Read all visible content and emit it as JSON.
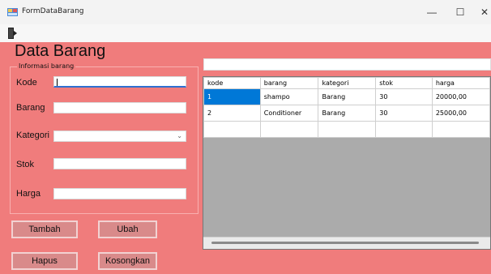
{
  "window": {
    "title": "FormDataBarang",
    "minimize": "—",
    "maximize": "☐",
    "close": "✕"
  },
  "form": {
    "heading": "Data Barang",
    "group_title": "Informasi barang",
    "fields": {
      "kode": {
        "label": "Kode",
        "value": ""
      },
      "barang": {
        "label": "Barang",
        "value": ""
      },
      "kategori": {
        "label": "Kategori",
        "value": ""
      },
      "stok": {
        "label": "Stok",
        "value": ""
      },
      "harga": {
        "label": "Harga",
        "value": ""
      }
    },
    "buttons": {
      "tambah": "Tambah",
      "ubah": "Ubah",
      "hapus": "Hapus",
      "kosongkan": "Kosongkan"
    },
    "search_value": ""
  },
  "grid": {
    "columns": [
      "kode",
      "barang",
      "kategori",
      "stok",
      "harga"
    ],
    "rows": [
      [
        "1",
        "shampo",
        "Barang",
        "30",
        "20000,00"
      ],
      [
        "2",
        "Conditioner",
        "Barang",
        "30",
        "25000,00"
      ],
      [
        "",
        "",
        "",
        "",
        ""
      ]
    ]
  },
  "colors": {
    "form_bg": "#f07c7c",
    "selection": "#0078d7"
  }
}
